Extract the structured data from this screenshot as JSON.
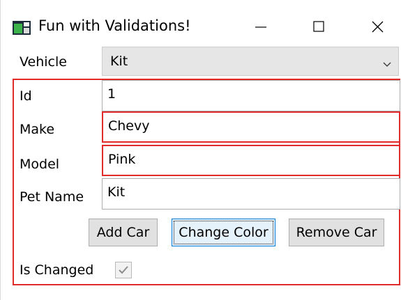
{
  "window": {
    "title": "Fun with Validations!",
    "icons": {
      "app": "app-icon",
      "minimize": "minimize-icon",
      "maximize": "maximize-icon",
      "close": "close-icon"
    }
  },
  "colors": {
    "error_border": "#e12b2b",
    "focus_border": "#0078d7",
    "button_bg": "#e1e1e1"
  },
  "vehicle": {
    "label": "Vehicle",
    "selected": "Kit",
    "icon": "chevron-down-icon"
  },
  "form": {
    "id": {
      "label": "Id",
      "value": "1",
      "has_error": false
    },
    "make": {
      "label": "Make",
      "value": "Chevy",
      "has_error": true
    },
    "model": {
      "label": "Model",
      "value": "Pink",
      "has_error": true
    },
    "petname": {
      "label": "Pet Name",
      "value": "Kit",
      "has_error": false
    }
  },
  "buttons": {
    "add": "Add Car",
    "change_color": "Change Color",
    "remove": "Remove Car"
  },
  "is_changed": {
    "label": "Is Changed",
    "checked": true,
    "icon": "checkmark-icon"
  }
}
